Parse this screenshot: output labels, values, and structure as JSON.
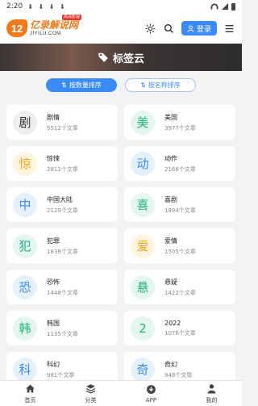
{
  "status": {
    "time": "2:20",
    "downloads": "⬇ ⬇ ⬇ ⬇"
  },
  "header": {
    "logo_mark": "12",
    "logo_cn": "亿录解说网",
    "logo_en": "JIYILU.COM",
    "logo_badge": "高清影视",
    "login_label": "登录"
  },
  "banner": {
    "title": "标签云"
  },
  "sort": {
    "by_count": "按数量排序",
    "by_name": "按名称排序"
  },
  "tags": [
    {
      "char": "剧",
      "name": "剧情",
      "count": "5512个文章",
      "bg": "#eeeeee",
      "fg": "#333333"
    },
    {
      "char": "美",
      "name": "美国",
      "count": "3977个文章",
      "bg": "#e3f7ee",
      "fg": "#21b577"
    },
    {
      "char": "惊",
      "name": "惊悚",
      "count": "2811个文章",
      "bg": "#fff5de",
      "fg": "#f4a623"
    },
    {
      "char": "动",
      "name": "动作",
      "count": "2166个文章",
      "bg": "#e5f0fd",
      "fg": "#3a8bf7"
    },
    {
      "char": "中",
      "name": "中国大陆",
      "count": "2129个文章",
      "bg": "#e5f0fd",
      "fg": "#3a8bf7"
    },
    {
      "char": "喜",
      "name": "喜剧",
      "count": "1894个文章",
      "bg": "#e3f7ee",
      "fg": "#21b577"
    },
    {
      "char": "犯",
      "name": "犯罪",
      "count": "1838个文章",
      "bg": "#e3f7ee",
      "fg": "#21b577"
    },
    {
      "char": "爱",
      "name": "爱情",
      "count": "1505个文章",
      "bg": "#fff5de",
      "fg": "#f4a623"
    },
    {
      "char": "恐",
      "name": "恐怖",
      "count": "1448个文章",
      "bg": "#e5f0fd",
      "fg": "#3a8bf7"
    },
    {
      "char": "悬",
      "name": "悬疑",
      "count": "1422个文章",
      "bg": "#e3f7ee",
      "fg": "#21b577"
    },
    {
      "char": "韩",
      "name": "韩国",
      "count": "1135个文章",
      "bg": "#e3f7ee",
      "fg": "#21b577"
    },
    {
      "char": "2",
      "name": "2022",
      "count": "1076个文章",
      "bg": "#e3f7ee",
      "fg": "#21b577"
    },
    {
      "char": "科",
      "name": "科幻",
      "count": "981个文章",
      "bg": "#e5f0fd",
      "fg": "#3a8bf7"
    },
    {
      "char": "奇",
      "name": "奇幻",
      "count": "948个文章",
      "bg": "#e5f0fd",
      "fg": "#3a8bf7"
    }
  ],
  "tabbar": {
    "home": "首页",
    "category": "分类",
    "app": "APP",
    "mine": "我的"
  }
}
